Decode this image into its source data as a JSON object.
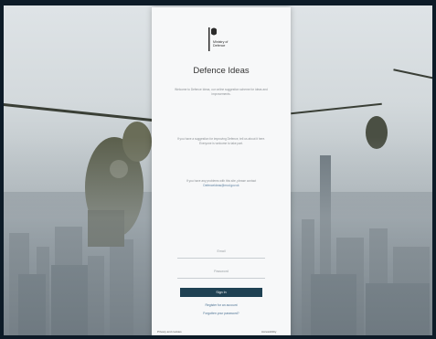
{
  "app": {
    "org_name": "Ministry of Defence",
    "title": "Defence Ideas"
  },
  "intro": {
    "paragraph_1": "Welcome to Defence Ideas, our online suggestion scheme for ideas and improvements.",
    "paragraph_2": "If you have a suggestion for improving Defence, tell us about it here. Everyone is welcome to take part.",
    "paragraph_3_prefix": "If you have any problems with this site, please contact",
    "support_email": "DefenceIdeas@mod.gov.uk"
  },
  "form": {
    "email_placeholder": "Email",
    "password_placeholder": "Password",
    "sign_in_label": "Sign In",
    "register_link": "Register for an account",
    "forgot_link": "Forgotten your password?"
  },
  "footer": {
    "left": "Privacy and cookies",
    "right": "Accessibility"
  },
  "colors": {
    "primary_button": "#1f4153",
    "link": "#4d7394"
  }
}
